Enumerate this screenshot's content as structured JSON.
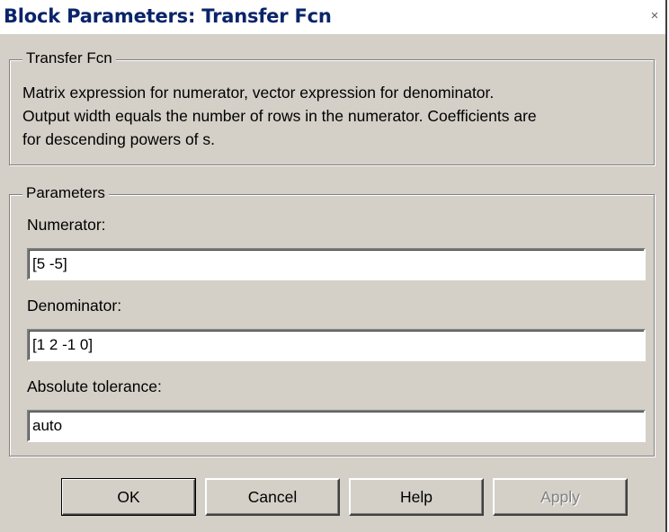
{
  "window": {
    "title": "Block Parameters: Transfer Fcn",
    "close_glyph": "×"
  },
  "description_group": {
    "legend": "Transfer Fcn",
    "lines": [
      "Matrix expression for numerator, vector expression for denominator.",
      "Output width equals the number of rows in the numerator.  Coefficients are",
      "for descending powers of s."
    ]
  },
  "parameters_group": {
    "legend": "Parameters",
    "numerator": {
      "label": "Numerator:",
      "value": "[5 -5]"
    },
    "denominator": {
      "label": "Denominator:",
      "value": "[1  2 -1 0]"
    },
    "absolute_tolerance": {
      "label": "Absolute tolerance:",
      "value": "auto"
    }
  },
  "buttons": {
    "ok": "OK",
    "cancel": "Cancel",
    "help": "Help",
    "apply": "Apply",
    "apply_enabled": false
  },
  "colors": {
    "dialog_face": "#d4d0c8",
    "title_text": "#0a246a",
    "disabled_text": "#808080"
  }
}
